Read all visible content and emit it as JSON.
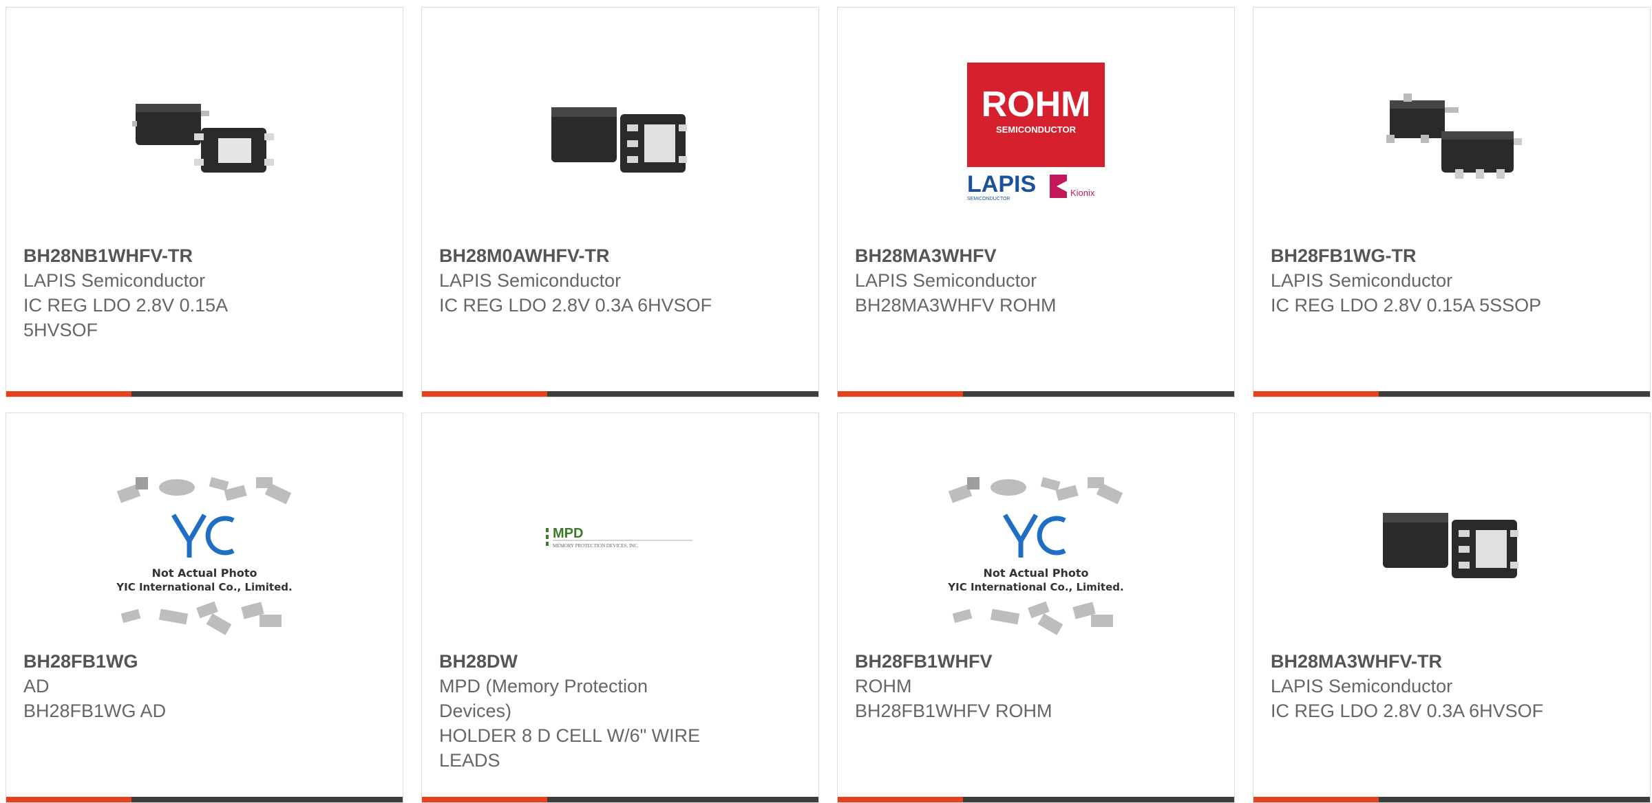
{
  "colors": {
    "accent": "#e8401c",
    "bar": "#3e3e3e",
    "text": "#666666",
    "rohm_red": "#d7202e",
    "lapis_blue": "#1c4f9c",
    "yic_blue": "#1e6fc4",
    "mpd_green": "#3a7a2a"
  },
  "products": [
    {
      "part_number": "BH28NB1WHFV-TR",
      "manufacturer": "LAPIS Semiconductor",
      "description": "IC REG LDO 2.8V 0.15A 5HVSOF",
      "image": "ic-5hvsof-package-photo"
    },
    {
      "part_number": "BH28M0AWHFV-TR",
      "manufacturer": "LAPIS Semiconductor",
      "description": "IC REG LDO 2.8V 0.3A 6HVSOF",
      "image": "ic-6hvsof-package-photo"
    },
    {
      "part_number": "BH28MA3WHFV",
      "manufacturer": "LAPIS Semiconductor",
      "description": "BH28MA3WHFV ROHM",
      "image": "rohm-lapis-kionix-logo",
      "logo": {
        "rohm": "ROHM",
        "rohm_sub": "SEMICONDUCTOR",
        "lapis": "LAPIS",
        "lapis_sub": "SEMICONDUCTOR",
        "kionix": "Kionix"
      }
    },
    {
      "part_number": "BH28FB1WG-TR",
      "manufacturer": "LAPIS Semiconductor",
      "description": "IC REG LDO 2.8V 0.15A 5SSOP",
      "image": "ic-5ssop-package-photo"
    },
    {
      "part_number": "BH28FB1WG",
      "manufacturer": "AD",
      "description": "BH28FB1WG AD",
      "image": "yic-placeholder",
      "placeholder": {
        "line1": "Not Actual Photo",
        "line2": "YIC International Co., Limited."
      }
    },
    {
      "part_number": "BH28DW",
      "manufacturer": "MPD (Memory Protection Devices)",
      "description": "HOLDER 8 D CELL W/6\" WIRE LEADS",
      "image": "mpd-logo",
      "logo": {
        "mpd": "MPD",
        "mpd_sub": "MEMORY PROTECTION DEVICES, INC."
      }
    },
    {
      "part_number": "BH28FB1WHFV",
      "manufacturer": "ROHM",
      "description": "BH28FB1WHFV ROHM",
      "image": "yic-placeholder",
      "placeholder": {
        "line1": "Not Actual Photo",
        "line2": "YIC International Co., Limited."
      }
    },
    {
      "part_number": "BH28MA3WHFV-TR",
      "manufacturer": "LAPIS Semiconductor",
      "description": "IC REG LDO 2.8V 0.3A 6HVSOF",
      "image": "ic-6hvsof-package-photo"
    }
  ]
}
